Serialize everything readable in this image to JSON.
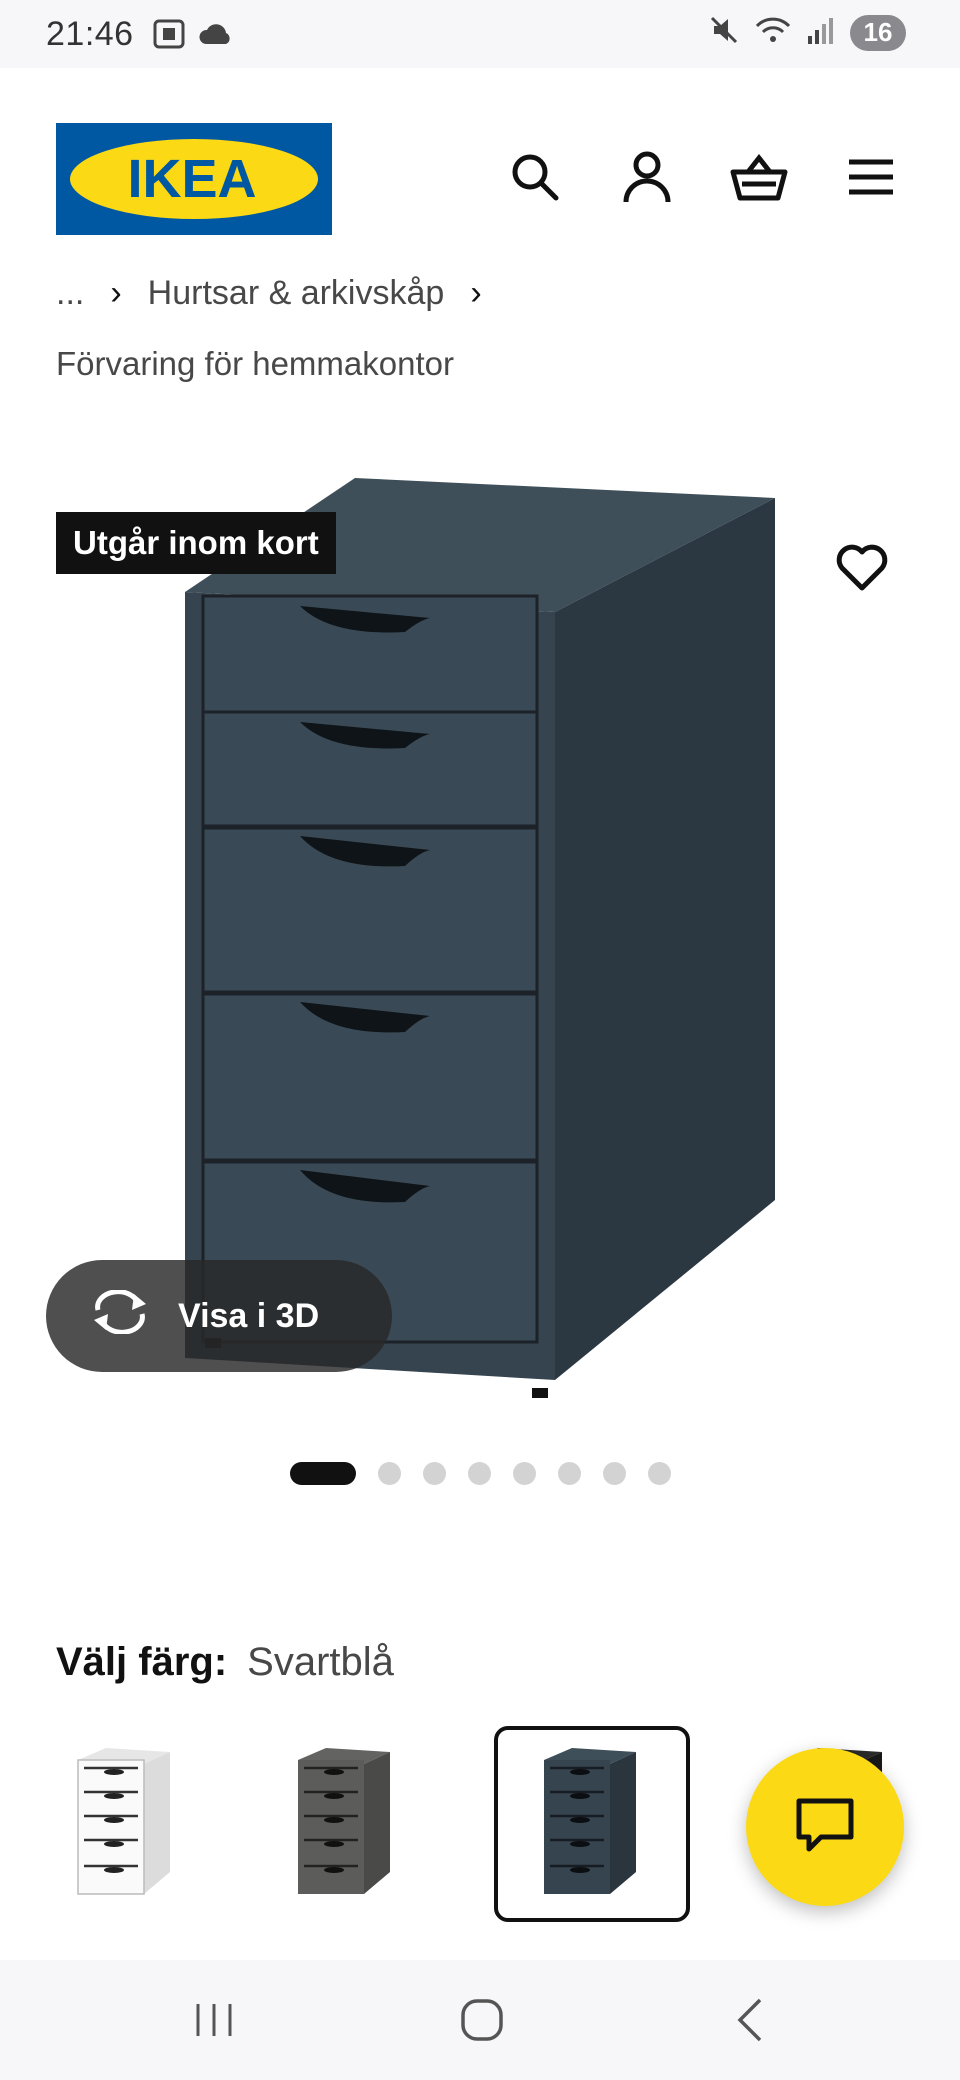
{
  "status_bar": {
    "time": "21:46",
    "battery": "16",
    "icons": [
      "screenshot-icon",
      "cloud-icon",
      "mute-icon",
      "wifi-icon",
      "signal-icon"
    ]
  },
  "header": {
    "logo_text": "IKEA",
    "icons": [
      "search-icon",
      "account-icon",
      "cart-icon",
      "menu-icon"
    ]
  },
  "breadcrumb": {
    "ellipsis": "...",
    "parent": "Hurtsar & arkivskåp",
    "current": "Förvaring för hemmakontor"
  },
  "product": {
    "badge": "Utgår inom kort",
    "view_3d_label": "Visa i 3D",
    "image_count": 8,
    "active_image": 1
  },
  "color": {
    "label": "Välj färg:",
    "selected": "Svartblå",
    "options": [
      {
        "name": "white",
        "color": "#f2f2f2"
      },
      {
        "name": "gray",
        "color": "#5a5a58"
      },
      {
        "name": "svartbla",
        "color": "#2f3c47"
      },
      {
        "name": "black",
        "color": "#1e1e1e"
      }
    ]
  },
  "colors": {
    "ikea_blue": "#0058a3",
    "ikea_yellow": "#fbd914",
    "product_blue": "#35444f"
  }
}
